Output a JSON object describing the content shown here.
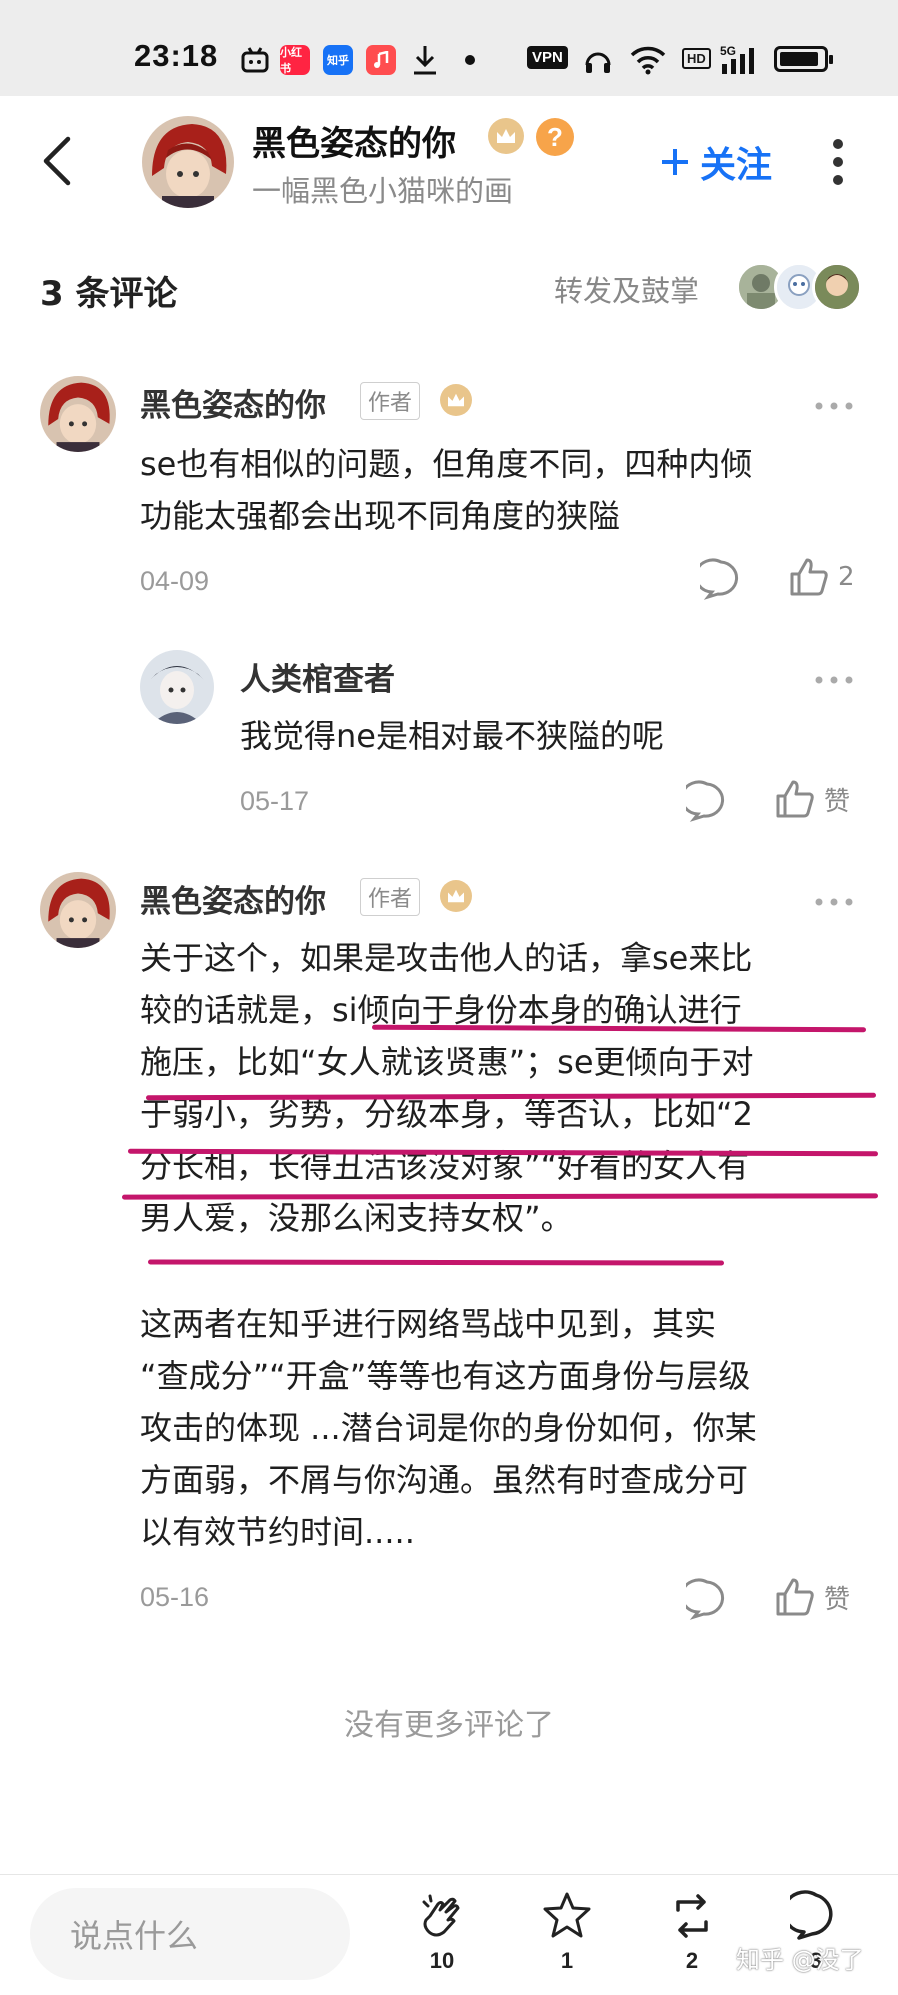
{
  "status_bar": {
    "time": "23:18",
    "apps": [
      "小红书",
      "知乎"
    ],
    "vpn": "VPN",
    "hd": "HD",
    "network": "5G",
    "battery_level": 0.9
  },
  "header": {
    "title": "黑色姿态的你",
    "subtitle": "一幅黑色小猫咪的画",
    "follow_label": "关注",
    "question_mark": "?"
  },
  "comments_header": {
    "count_label": "3 条评论",
    "repost_label": "转发及鼓掌"
  },
  "comments": [
    {
      "name": "黑色姿态的你",
      "tag": "作者",
      "lines": [
        "se也有相似的问题，但角度不同，四种内倾",
        "功能太强都会出现不同角度的狭隘"
      ],
      "date": "04-09",
      "likes": "2"
    },
    {
      "name": "人类棺查者",
      "lines": [
        "我觉得ne是相对最不狭隘的呢"
      ],
      "date": "05-17",
      "likes": "赞"
    },
    {
      "name": "黑色姿态的你",
      "tag": "作者",
      "lines": [
        "关于这个，如果是攻击他人的话，拿se来比",
        "较的话就是，si倾向于身份本身的确认进行",
        "施压，比如“女人就该贤惠”；se更倾向于对",
        "于弱小，劣势，分级本身，等否认，比如“2",
        "分长相，长得丑活该没对象”“好看的女人有",
        "男人爱，没那么闲支持女权”。",
        "",
        "这两者在知乎进行网络骂战中见到，其实",
        "“查成分”“开盒”等等也有这方面身份与层级",
        "攻击的体现 ...潜台词是你的身份如何，你某",
        "方面弱，不屑与你沟通。虽然有时查成分可",
        "以有效节约时间....."
      ],
      "date": "05-16",
      "likes": "赞"
    }
  ],
  "end_text": "没有更多评论了",
  "bottom_bar": {
    "input_placeholder": "说点什么",
    "clap_count": "10",
    "favorite_count": "1",
    "repost_count": "2",
    "comment_count": "3",
    "watermark": "知乎 @没了"
  },
  "colors": {
    "accent_blue": "#1772f6",
    "highlight": "#c4166b",
    "crown_gold": "#e9c58b"
  }
}
